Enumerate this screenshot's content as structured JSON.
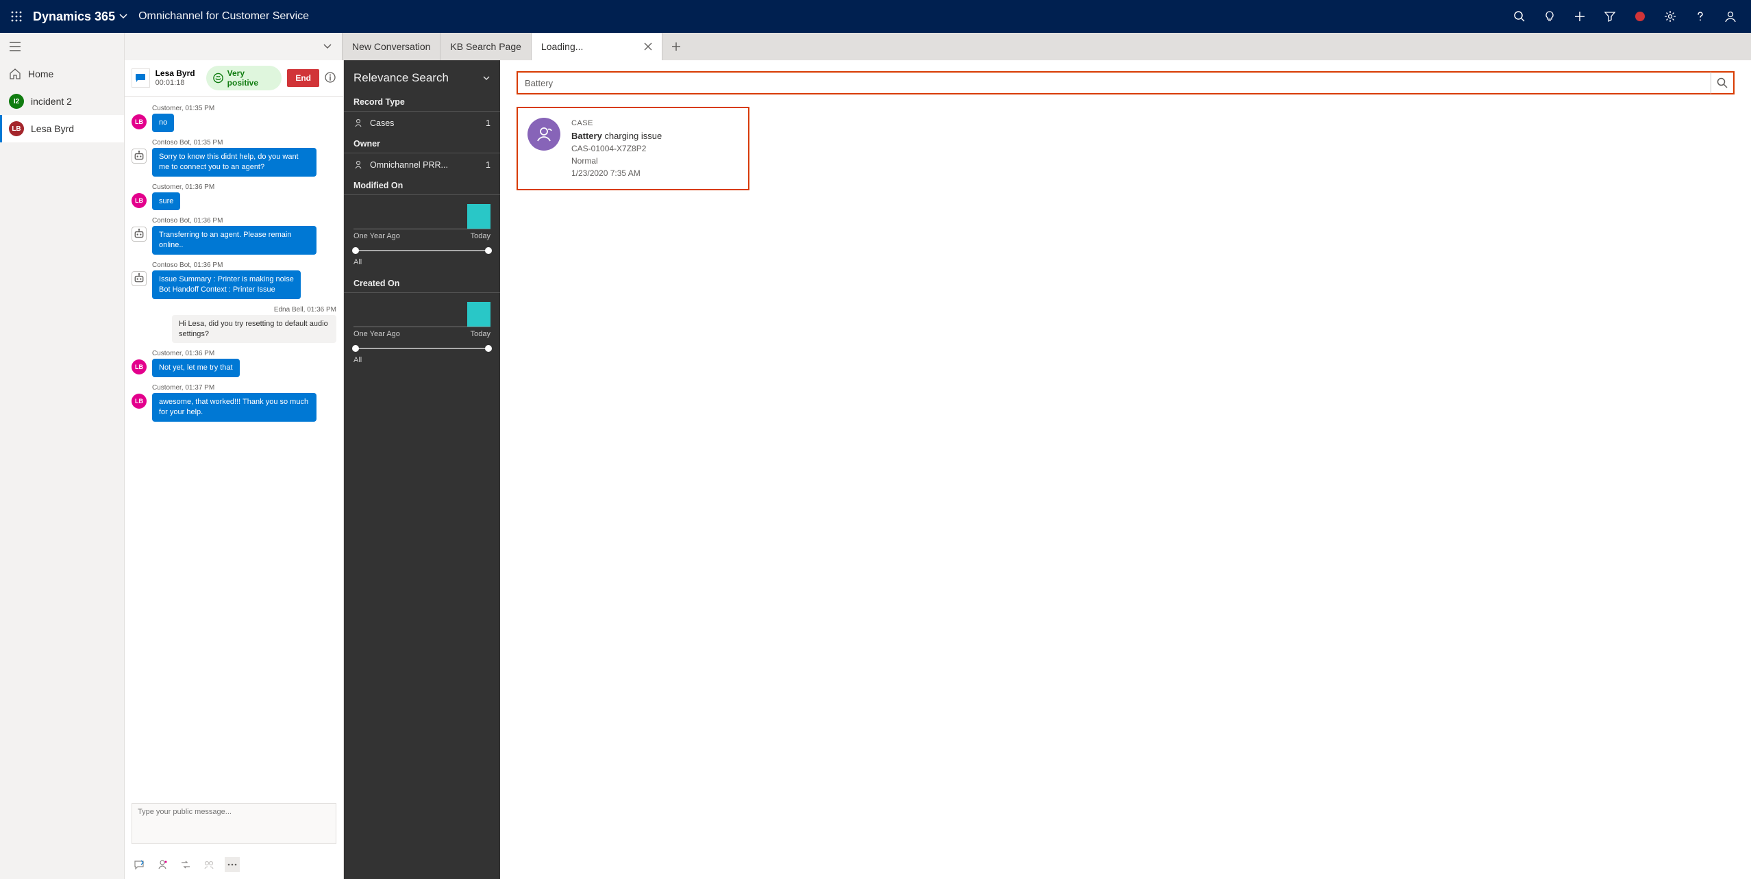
{
  "topbar": {
    "brand": "Dynamics 365",
    "subtitle": "Omnichannel for Customer Service"
  },
  "leftnav": {
    "items": [
      {
        "id": "home",
        "label": "Home",
        "icon": "home"
      },
      {
        "id": "incident2",
        "label": "incident 2",
        "avatar_text": "I2",
        "avatar_class": "av-green"
      },
      {
        "id": "lesa",
        "label": "Lesa Byrd",
        "avatar_text": "LB",
        "avatar_class": "av-maroon",
        "selected": true
      }
    ]
  },
  "tabs": {
    "items": [
      {
        "id": "newconv",
        "label": "New Conversation"
      },
      {
        "id": "kb",
        "label": "KB Search Page"
      },
      {
        "id": "loading",
        "label": "Loading...",
        "active": true,
        "closable": true
      }
    ]
  },
  "chat": {
    "header": {
      "name": "Lesa Byrd",
      "elapsed": "00:01:18",
      "sentiment": "Very positive",
      "end_label": "End"
    },
    "messages": [
      {
        "kind": "customer",
        "avatar": "LB",
        "meta": "Customer, 01:35 PM",
        "text": "no"
      },
      {
        "kind": "bot",
        "meta": "Contoso Bot, 01:35 PM",
        "text": "Sorry to know this didnt help, do you want me to connect you to an agent?"
      },
      {
        "kind": "customer",
        "avatar": "LB",
        "meta": "Customer, 01:36 PM",
        "text": "sure"
      },
      {
        "kind": "bot",
        "meta": "Contoso Bot, 01:36 PM",
        "text": "Transferring to an agent. Please remain online.."
      },
      {
        "kind": "bot",
        "meta": "Contoso Bot, 01:36 PM",
        "text": "Issue Summary : Printer is making noise\nBot Handoff Context : Printer Issue"
      },
      {
        "kind": "agent",
        "meta": "Edna Bell,  01:36 PM",
        "text": "Hi Lesa, did you try resetting to default audio settings?"
      },
      {
        "kind": "customer",
        "avatar": "LB",
        "meta": "Customer, 01:36 PM",
        "text": "Not yet, let me try that"
      },
      {
        "kind": "customer",
        "avatar": "LB",
        "meta": "Customer, 01:37 PM",
        "text": "awesome, that worked!!! Thank you so much for your help."
      }
    ],
    "input_placeholder": "Type your public message..."
  },
  "relevance": {
    "title": "Relevance Search",
    "record_type_label": "Record Type",
    "cases_label": "Cases",
    "cases_count": "1",
    "owner_label": "Owner",
    "owner_name": "Omnichannel PRR...",
    "owner_count": "1",
    "modified_label": "Modified On",
    "created_label": "Created On",
    "axis_left": "One Year Ago",
    "axis_right": "Today",
    "all_label": "All"
  },
  "search": {
    "query": "Battery",
    "result": {
      "type": "CASE",
      "title_bold": "Battery",
      "title_rest": " charging issue",
      "caseno": "CAS-01004-X7Z8P2",
      "priority": "Normal",
      "datetime": "1/23/2020 7:35 AM"
    }
  },
  "chart_data": [
    {
      "type": "bar",
      "name": "Modified On",
      "categories": [
        "bucket1",
        "bucket2",
        "bucket3",
        "bucket4",
        "bucket5"
      ],
      "values": [
        0,
        0,
        0,
        0,
        1
      ],
      "xlabel_left": "One Year Ago",
      "xlabel_right": "Today",
      "slider_range_label": "All"
    },
    {
      "type": "bar",
      "name": "Created On",
      "categories": [
        "bucket1",
        "bucket2",
        "bucket3",
        "bucket4",
        "bucket5"
      ],
      "values": [
        0,
        0,
        0,
        0,
        1
      ],
      "xlabel_left": "One Year Ago",
      "xlabel_right": "Today",
      "slider_range_label": "All"
    }
  ]
}
